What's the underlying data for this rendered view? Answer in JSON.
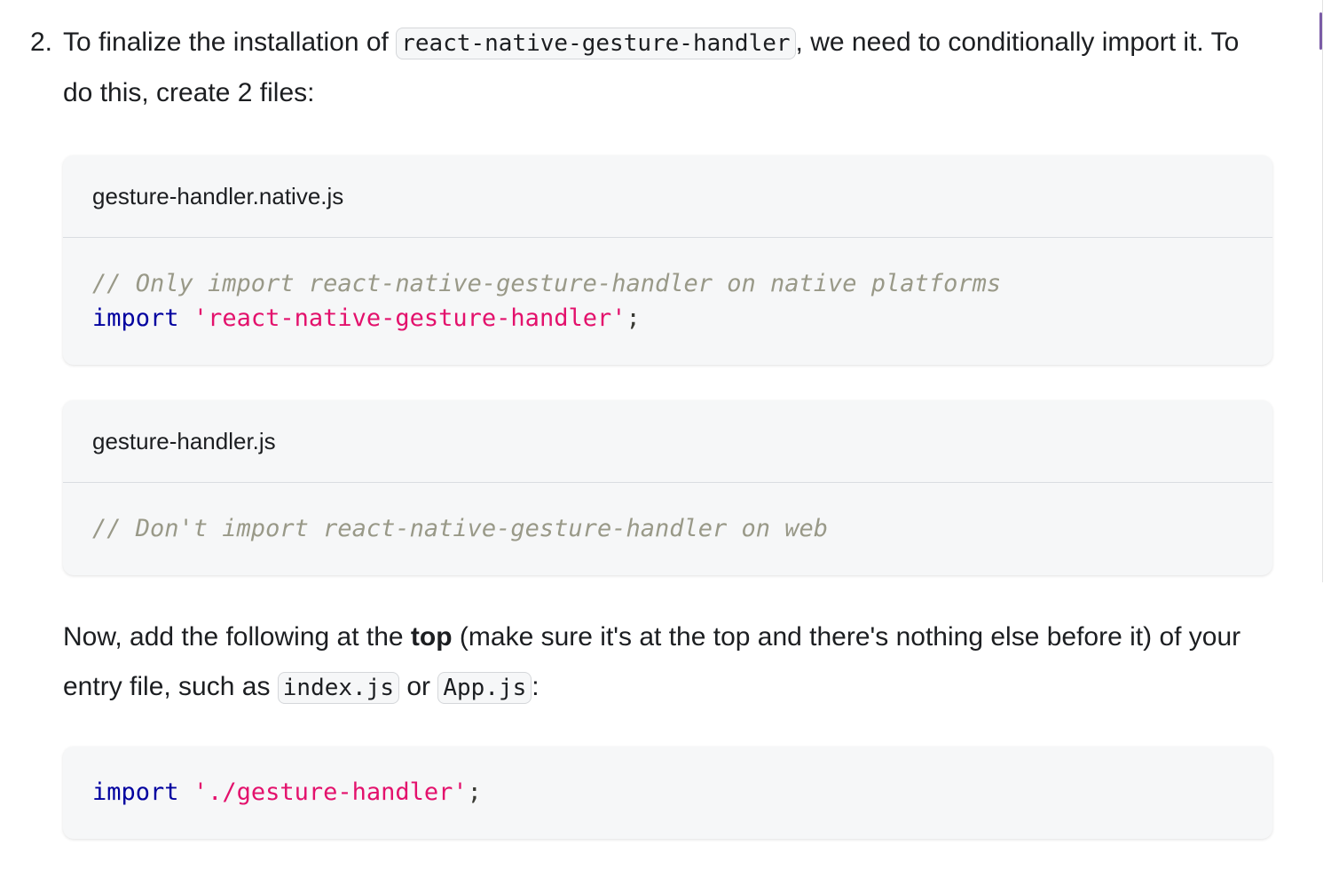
{
  "step": {
    "number": "2.",
    "text_before": "To finalize the installation of ",
    "code_package": "react-native-gesture-handler",
    "text_after": ", we need to conditionally import it. To do this, create 2 files:"
  },
  "files": [
    {
      "filename": "gesture-handler.native.js",
      "lines": [
        {
          "comment": "// Only import react-native-gesture-handler on native platforms"
        },
        {
          "keyword": "import",
          "string": "'react-native-gesture-handler'",
          "punct": ";"
        }
      ]
    },
    {
      "filename": "gesture-handler.js",
      "lines": [
        {
          "comment": "// Don't import react-native-gesture-handler on web"
        }
      ]
    }
  ],
  "instruction": {
    "text_1": "Now, add the following at the ",
    "bold": "top",
    "text_2": " (make sure it's at the top and there's nothing else before it) of your entry file, such as ",
    "code_1": "index.js",
    "text_3": " or ",
    "code_2": "App.js",
    "text_4": ":"
  },
  "entry_code": {
    "keyword": "import",
    "string": "'./gesture-handler'",
    "punct": ";"
  },
  "colors": {
    "comment": "#999988",
    "keyword": "#00009f",
    "string": "#e3116c",
    "code_background": "#f6f7f8",
    "scroll_indicator": "#7a5ba6"
  }
}
